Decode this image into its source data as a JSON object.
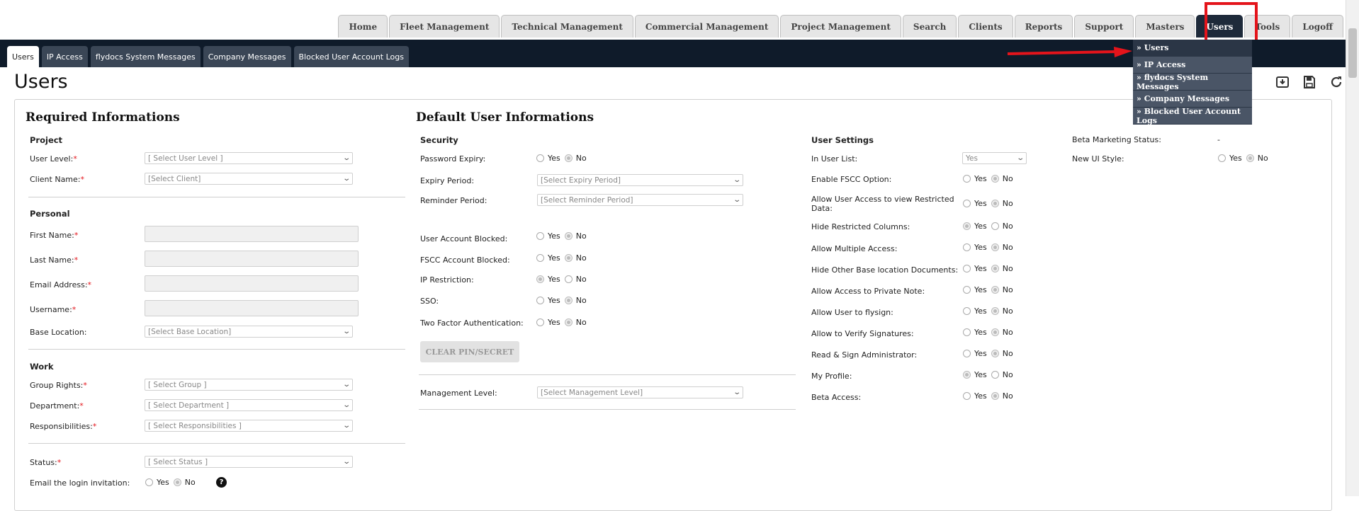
{
  "main_tabs": [
    "Home",
    "Fleet Management",
    "Technical Management",
    "Commercial Management",
    "Project Management",
    "Search",
    "Clients",
    "Reports",
    "Support",
    "Masters",
    "Users",
    "Tools",
    "Logoff"
  ],
  "sub_tabs": [
    "Users",
    "IP Access",
    "flydocs System Messages",
    "Company Messages",
    "Blocked User Account Logs"
  ],
  "dropdown": [
    "» Users",
    "» IP Access",
    "» flydocs System Messages",
    "» Company Messages",
    "» Blocked User Account Logs"
  ],
  "page_title": "Users",
  "required": {
    "title": "Required Informations",
    "project": "Project",
    "user_level": {
      "label": "User Level:",
      "placeholder": "[ Select User Level ]"
    },
    "client_name": {
      "label": "Client Name:",
      "placeholder": "[Select Client]"
    },
    "personal": "Personal",
    "first_name": "First Name:",
    "last_name": "Last Name:",
    "email": "Email Address:",
    "username": "Username:",
    "base_location": {
      "label": "Base Location:",
      "placeholder": "[Select Base Location]"
    },
    "work": "Work",
    "group_rights": {
      "label": "Group Rights:",
      "placeholder": "[ Select Group ]"
    },
    "department": {
      "label": "Department:",
      "placeholder": "[ Select Department ]"
    },
    "responsibilities": {
      "label": "Responsibilities:",
      "placeholder": "[ Select Responsibilities ]"
    },
    "status": {
      "label": "Status:",
      "placeholder": "[ Select Status ]"
    },
    "email_invite": "Email the login invitation:"
  },
  "defaults": {
    "title": "Default User Informations",
    "security": "Security",
    "password_expiry": "Password Expiry:",
    "expiry_period": {
      "label": "Expiry Period:",
      "placeholder": "[Select Expiry Period]"
    },
    "reminder_period": {
      "label": "Reminder Period:",
      "placeholder": "[Select Reminder Period]"
    },
    "user_blocked": "User Account Blocked:",
    "fscc_blocked": "FSCC Account Blocked:",
    "ip_restriction": "IP Restriction:",
    "sso": "SSO:",
    "two_factor": "Two Factor Authentication:",
    "clear_btn": "CLEAR PIN/SECRET",
    "mgmt_level": {
      "label": "Management Level:",
      "placeholder": "[Select Management Level]"
    }
  },
  "user_settings": {
    "title": "User Settings",
    "in_user_list": {
      "label": "In User List:",
      "value": "Yes"
    },
    "enable_fscc": "Enable FSCC Option:",
    "restricted_line1": "Allow User Access to view Restricted",
    "restricted_line2": "Data:",
    "hide_restricted": "Hide Restricted Columns:",
    "multi_access": "Allow Multiple Access:",
    "hide_other": "Hide Other Base location Documents:",
    "private_note": "Allow Access to Private Note:",
    "flysign": "Allow User to flysign:",
    "verify_sig": "Allow to Verify Signatures:",
    "read_sign": "Read & Sign Administrator:",
    "my_profile": "My Profile:",
    "beta_access": "Beta Access:"
  },
  "beta": {
    "marketing_label": "Beta Marketing Status:",
    "marketing_value": "-",
    "new_ui": "New UI Style:"
  },
  "radio": {
    "yes": "Yes",
    "no": "No"
  },
  "help": "?"
}
